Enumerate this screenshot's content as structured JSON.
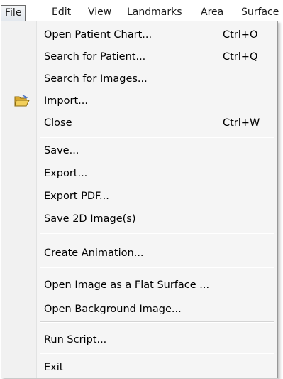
{
  "menubar": {
    "items": [
      {
        "label": "File"
      },
      {
        "label": "Edit"
      },
      {
        "label": "View"
      },
      {
        "label": "Landmarks"
      },
      {
        "label": "Area"
      },
      {
        "label": "Surface"
      }
    ]
  },
  "file_menu": {
    "items": [
      {
        "label": "Open Patient Chart...",
        "shortcut": "Ctrl+O"
      },
      {
        "label": "Search for Patient...",
        "shortcut": "Ctrl+Q"
      },
      {
        "label": "Search for Images..."
      },
      {
        "label": "Import...",
        "icon": "open-folder-icon"
      },
      {
        "label": "Close",
        "shortcut": "Ctrl+W"
      },
      {
        "label": "Save..."
      },
      {
        "label": "Export..."
      },
      {
        "label": "Export PDF..."
      },
      {
        "label": "Save 2D Image(s)"
      },
      {
        "label": "Create Animation..."
      },
      {
        "label": "Open Image as a Flat Surface ..."
      },
      {
        "label": "Open Background Image..."
      },
      {
        "label": "Run Script..."
      },
      {
        "label": "Exit"
      }
    ]
  },
  "colors": {
    "menu_background": "#f5f5f5",
    "menu_border": "#979797",
    "separator": "#d4d4d4",
    "folder_icon": "#e8c24a"
  }
}
